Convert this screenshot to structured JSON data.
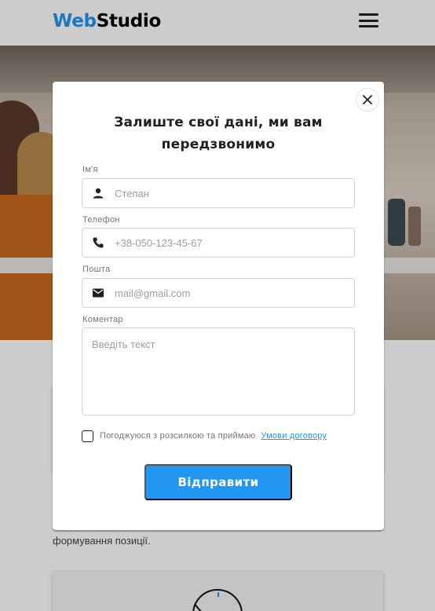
{
  "header": {
    "logo_part1": "Web",
    "logo_part2": "Studio",
    "menu_icon": "hamburger-menu-icon"
  },
  "background": {
    "feature_text": "формування позиції.",
    "card_icon": "clock-icon"
  },
  "modal": {
    "title": "Залиште свої дані, ми вам передзвонимо",
    "close_icon": "close-icon",
    "fields": {
      "name": {
        "label": "Ім'я",
        "placeholder": "Степан",
        "icon": "person-icon"
      },
      "phone": {
        "label": "Телефон",
        "placeholder": "+38-050-123-45-67",
        "icon": "phone-icon"
      },
      "email": {
        "label": "Пошта",
        "placeholder": "mail@gmail.com",
        "icon": "mail-icon"
      },
      "comment": {
        "label": "Коментар",
        "placeholder": "Введіть текст"
      }
    },
    "agree_text": "Погоджуюся з розсилкою та приймаю",
    "agree_link": "Умови договору",
    "submit_label": "Відправити"
  },
  "colors": {
    "accent": "#2196f3",
    "text_dark": "#212121",
    "placeholder": "#9e9e9e",
    "overlay": "rgba(0,0,0,0.2)"
  }
}
